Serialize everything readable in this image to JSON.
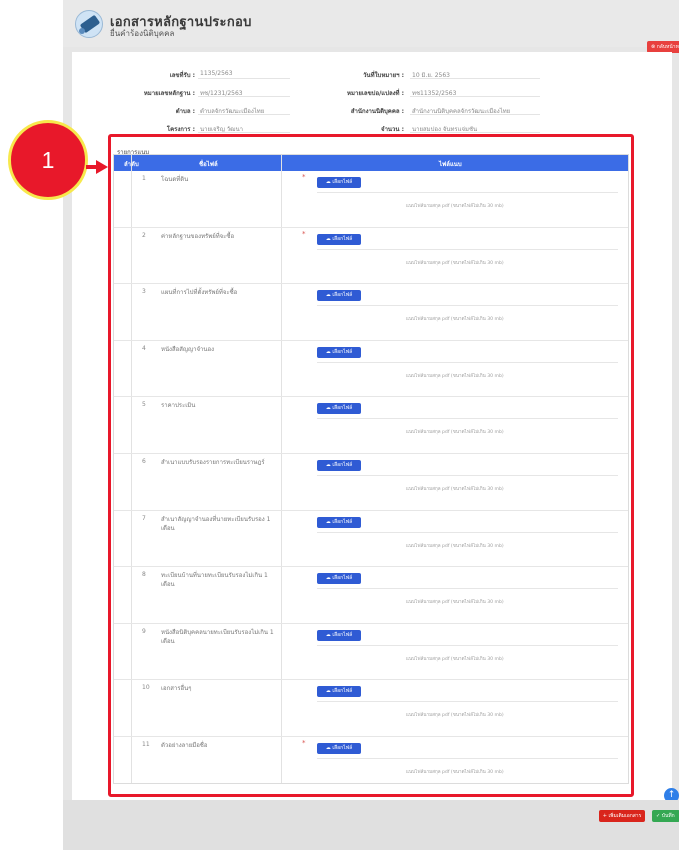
{
  "header": {
    "title": "เอกสารหลักฐานประกอบ",
    "subtitle": "ยื่นคำร้องนิติบุคคล",
    "back_label": "⊗ กลับหน้าหลัก"
  },
  "info": {
    "rows": [
      {
        "label_left": "เลขที่รับ :",
        "value_left": "1135/2563",
        "label_right": "วันที่ใบหมายฯ :",
        "value_right": "10 มิ.ย. 2563"
      },
      {
        "label_left": "หมายเลขหลักฐาน :",
        "value_left": "ทช/1231/2563",
        "label_right": "หมายเลขบ่อ/แปลงที่ :",
        "value_right": "ทช11352/2563"
      },
      {
        "label_left": "ตำบล :",
        "value_left": "ตำบลจักรวัฒนะเมืองไทย",
        "label_right": "สำนักงานนิติบุคคล :",
        "value_right": "สำนักงานนิติบุคคลจักรวัฒนะเมืองไทย"
      },
      {
        "label_left": "โครงการ :",
        "value_left": "นายเจริญ วัฒนา",
        "label_right": "จำนวน :",
        "value_right": "นายสมปอง จันทรแจ่มชัน"
      }
    ]
  },
  "section_label": "รายการแนบ",
  "table": {
    "headers": [
      "ลำดับ",
      "ชื่อไฟล์",
      "ไฟล์แนบ"
    ],
    "upload_label": "☁ เลือกไฟล์",
    "hint": "แนบไฟล์นามสกุล pdf (ขนาดไฟล์ไม่เกิน 30 mb)",
    "rows": [
      {
        "num": "1",
        "name": "โฉนดที่ดิน",
        "required": "*"
      },
      {
        "num": "2",
        "name": "ค่าหลักฐานของทรัพย์ที่จะซื้อ",
        "required": "*"
      },
      {
        "num": "3",
        "name": "แผนที่การไปที่ตั้งทรัพย์ที่จะซื้อ",
        "required": ""
      },
      {
        "num": "4",
        "name": "หนังสือสัญญาจำนอง",
        "required": ""
      },
      {
        "num": "5",
        "name": "ราคาประเมิน",
        "required": ""
      },
      {
        "num": "6",
        "name": "สำเนาแบบรับรองรายการทะเบียนราษฎร์",
        "required": ""
      },
      {
        "num": "7",
        "name": "สำเนาสัญญาจำนองที่นายทะเบียนรับรอง 1 เดือน",
        "required": ""
      },
      {
        "num": "8",
        "name": "ทะเบียนบ้านที่นายทะเบียนรับรองไม่เกิน 1 เดือน",
        "required": ""
      },
      {
        "num": "9",
        "name": "หนังสือนิติบุคคลนายทะเบียนรับรองไม่เกิน 1 เดือน",
        "required": ""
      },
      {
        "num": "10",
        "name": "เอกสารอื่นๆ",
        "required": ""
      },
      {
        "num": "11",
        "name": "ตัวอย่างลายมือชื่อ",
        "required": "*"
      }
    ]
  },
  "callout": {
    "number": "1"
  },
  "footer": {
    "add_label": "+ เพิ่มเติมเอกสาร",
    "save_label": "✓ บันทึก"
  },
  "colors": {
    "accent": "#3b6ce6",
    "highlight": "#e8182a",
    "callout_border": "#f7e84c",
    "save": "#34a853"
  }
}
